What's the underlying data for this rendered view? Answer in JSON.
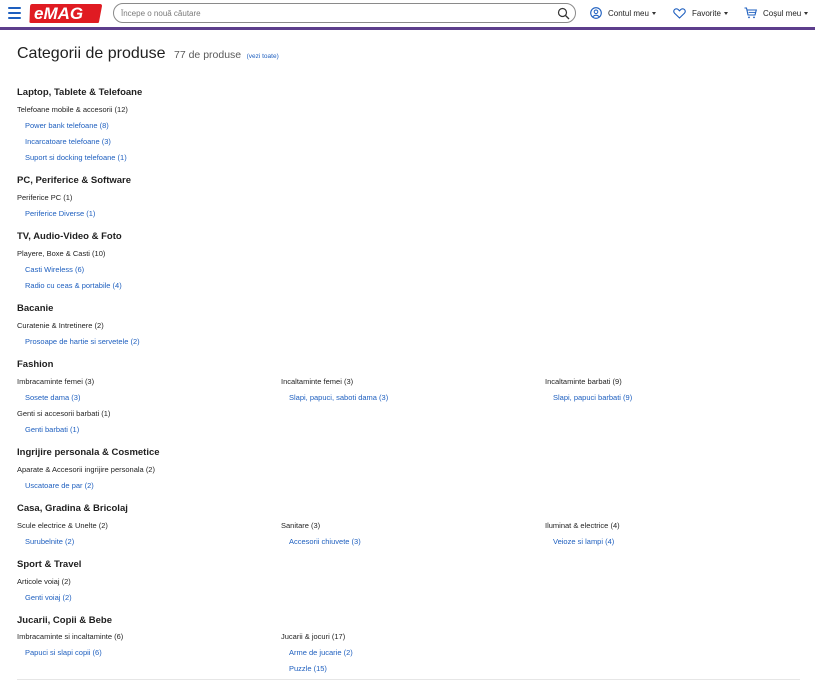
{
  "header": {
    "search_placeholder": "Începe o nouă căutare",
    "account_label": "Contul meu",
    "favorites_label": "Favorite",
    "cart_label": "Coșul meu",
    "logo_text": "eMAG",
    "brand_color": "#e01b22",
    "accent_color": "#5d3e8c",
    "link_color": "#1e5fbf"
  },
  "page": {
    "title": "Categorii de produse",
    "count": "77 de produse",
    "see_all": "(vezi toate)"
  },
  "sections": [
    {
      "title": "Laptop, Tablete & Telefoane",
      "groups": [
        {
          "label": "Telefoane mobile & accesorii (12)",
          "items": [
            "Power bank telefoane (8)",
            "Incarcatoare telefoane (3)",
            "Suport si docking telefoane (1)"
          ]
        }
      ]
    },
    {
      "title": "PC, Periferice & Software",
      "groups": [
        {
          "label": "Periferice PC (1)",
          "items": [
            "Periferice Diverse (1)"
          ]
        }
      ]
    },
    {
      "title": "TV, Audio-Video & Foto",
      "groups": [
        {
          "label": "Playere, Boxe & Casti (10)",
          "items": [
            "Casti Wireless (6)",
            "Radio cu ceas & portabile (4)"
          ]
        }
      ]
    },
    {
      "title": "Bacanie",
      "groups": [
        {
          "label": "Curatenie & Intretinere (2)",
          "items": [
            "Prosoape de hartie si servetele (2)"
          ]
        }
      ]
    },
    {
      "title": "Fashion",
      "groups": [
        {
          "label": "Imbracaminte femei (3)",
          "items": [
            "Sosete dama (3)"
          ]
        },
        {
          "label": "Incaltaminte femei (3)",
          "items": [
            "Slapi, papuci, saboti dama (3)"
          ]
        },
        {
          "label": "Incaltaminte barbati (9)",
          "items": [
            "Slapi, papuci barbati (9)"
          ]
        },
        {
          "label": "Genti si accesorii barbati (1)",
          "items": [
            "Genti barbati (1)"
          ]
        }
      ]
    },
    {
      "title": "Ingrijire personala & Cosmetice",
      "groups": [
        {
          "label": "Aparate & Accesorii ingrijire personala (2)",
          "items": [
            "Uscatoare de par (2)"
          ]
        }
      ]
    },
    {
      "title": "Casa, Gradina & Bricolaj",
      "groups": [
        {
          "label": "Scule electrice & Unelte (2)",
          "items": [
            "Surubelnite (2)"
          ]
        },
        {
          "label": "Sanitare (3)",
          "items": [
            "Accesorii chiuvete (3)"
          ]
        },
        {
          "label": "Iluminat & electrice (4)",
          "items": [
            "Veioze si lampi (4)"
          ]
        }
      ]
    },
    {
      "title": "Sport & Travel",
      "groups": [
        {
          "label": "Articole voiaj (2)",
          "items": [
            "Genti voiaj (2)"
          ]
        }
      ]
    },
    {
      "title": "Jucarii, Copii & Bebe",
      "groups": [
        {
          "label": "Imbracaminte si incaltaminte (6)",
          "items": [
            "Papuci si slapi copii (6)"
          ]
        },
        {
          "label": "Jucarii & jocuri (17)",
          "items": [
            "Arme de jucarie (2)",
            "Puzzle (15)"
          ]
        }
      ]
    }
  ]
}
